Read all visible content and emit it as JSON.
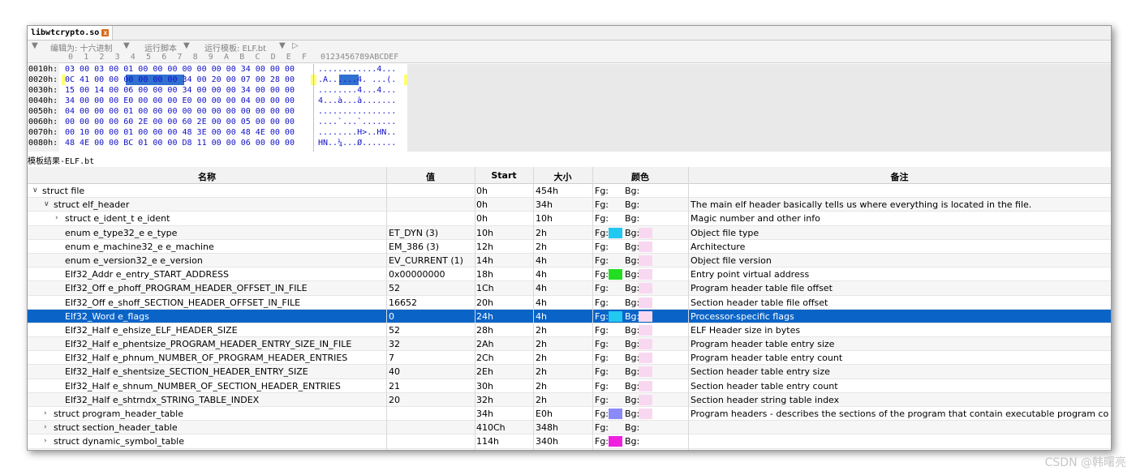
{
  "tab": {
    "title": "libwtcrypto.so",
    "close": "x"
  },
  "toolbar": {
    "arrow": "▼",
    "edit_as": "编辑为: 十六进制",
    "run_script": "运行脚本",
    "run_template": "运行模板: ELF.bt",
    "play": "▷",
    "dropdown": "▼"
  },
  "hex_header": {
    "columns": [
      "0",
      "1",
      "2",
      "3",
      "4",
      "5",
      "6",
      "7",
      "8",
      "9",
      "A",
      "B",
      "C",
      "D",
      "E",
      "F"
    ],
    "ascii_header": "0123456789ABCDEF"
  },
  "hex_rows": [
    {
      "addr": "0010h:",
      "bytes": "03 00 03 00 01 00 00 00 00 00 00 00 34 00 00 00",
      "ascii": "............4..."
    },
    {
      "addr": "0020h:",
      "bytes": "0C 41 00 00 00 00 00 00 34 00 20 00 07 00 28 00",
      "ascii": ".A......4. ...(."
    },
    {
      "addr": "0030h:",
      "bytes": "15 00 14 00 06 00 00 00 34 00 00 00 34 00 00 00",
      "ascii": "........4...4..."
    },
    {
      "addr": "0040h:",
      "bytes": "34 00 00 00 E0 00 00 00 E0 00 00 00 04 00 00 00",
      "ascii": "4...à...à......."
    },
    {
      "addr": "0050h:",
      "bytes": "04 00 00 00 01 00 00 00 00 00 00 00 00 00 00 00",
      "ascii": "................"
    },
    {
      "addr": "0060h:",
      "bytes": "00 00 00 00 60 2E 00 00 60 2E 00 00 05 00 00 00",
      "ascii": "....`...`......."
    },
    {
      "addr": "0070h:",
      "bytes": "00 10 00 00 01 00 00 00 48 3E 00 00 48 4E 00 00",
      "ascii": "........H>..HN.."
    },
    {
      "addr": "0080h:",
      "bytes": "48 4E 00 00 BC 01 00 00 D8 11 00 00 06 00 00 00",
      "ascii": "HN..¼...Ø......."
    }
  ],
  "results_label": "模板结果-ELF.bt",
  "columns": {
    "name": "名称",
    "value": "值",
    "start": "Start",
    "size": "大小",
    "color": "颜色",
    "comment": "备注"
  },
  "rows": [
    {
      "indent": 0,
      "chevron": "∨",
      "name": "struct file",
      "value": "",
      "start": "0h",
      "size": "454h",
      "fg": "Fg:",
      "bg": "Bg:",
      "fg_color": "",
      "bg_color": "",
      "comment": ""
    },
    {
      "indent": 1,
      "chevron": "∨",
      "name": "struct elf_header",
      "value": "",
      "start": "0h",
      "size": "34h",
      "fg": "Fg:",
      "bg": "Bg:",
      "fg_color": "",
      "bg_color": "",
      "comment": "The main elf header basically tells us where everything is located in the file."
    },
    {
      "indent": 2,
      "chevron": "›",
      "name": "struct e_ident_t e_ident",
      "value": "",
      "start": "0h",
      "size": "10h",
      "fg": "Fg:",
      "bg": "Bg:",
      "fg_color": "",
      "bg_color": "",
      "comment": "Magic number and other info"
    },
    {
      "indent": 2,
      "chevron": "",
      "name": "enum e_type32_e e_type",
      "value": "ET_DYN (3)",
      "start": "10h",
      "size": "2h",
      "fg": "Fg:",
      "bg": "Bg:",
      "fg_color": "#22c8f0",
      "bg_color": "#f8d8f0",
      "comment": "Object file type"
    },
    {
      "indent": 2,
      "chevron": "",
      "name": "enum e_machine32_e e_machine",
      "value": "EM_386 (3)",
      "start": "12h",
      "size": "2h",
      "fg": "Fg:",
      "bg": "Bg:",
      "fg_color": "",
      "bg_color": "#f8d8f0",
      "comment": "Architecture"
    },
    {
      "indent": 2,
      "chevron": "",
      "name": "enum e_version32_e e_version",
      "value": "EV_CURRENT (1)",
      "start": "14h",
      "size": "4h",
      "fg": "Fg:",
      "bg": "Bg:",
      "fg_color": "",
      "bg_color": "#f8d8f0",
      "comment": "Object file version"
    },
    {
      "indent": 2,
      "chevron": "",
      "name": "Elf32_Addr e_entry_START_ADDRESS",
      "value": "0x00000000",
      "start": "18h",
      "size": "4h",
      "fg": "Fg:",
      "bg": "Bg:",
      "fg_color": "#22dd22",
      "bg_color": "#f8d8f0",
      "comment": "Entry point virtual address"
    },
    {
      "indent": 2,
      "chevron": "",
      "name": "Elf32_Off e_phoff_PROGRAM_HEADER_OFFSET_IN_FILE",
      "value": "52",
      "start": "1Ch",
      "size": "4h",
      "fg": "Fg:",
      "bg": "Bg:",
      "fg_color": "",
      "bg_color": "#f8d8f0",
      "comment": "Program header table file offset"
    },
    {
      "indent": 2,
      "chevron": "",
      "name": "Elf32_Off e_shoff_SECTION_HEADER_OFFSET_IN_FILE",
      "value": "16652",
      "start": "20h",
      "size": "4h",
      "fg": "Fg:",
      "bg": "Bg:",
      "fg_color": "",
      "bg_color": "#f8d8f0",
      "comment": "Section header table file offset"
    },
    {
      "indent": 2,
      "chevron": "",
      "name": "Elf32_Word e_flags",
      "value": "0",
      "start": "24h",
      "size": "4h",
      "fg": "Fg:",
      "bg": "Bg:",
      "fg_color": "#22c8f0",
      "bg_color": "#f8d8f0",
      "comment": "Processor-specific flags",
      "selected": true
    },
    {
      "indent": 2,
      "chevron": "",
      "name": "Elf32_Half e_ehsize_ELF_HEADER_SIZE",
      "value": "52",
      "start": "28h",
      "size": "2h",
      "fg": "Fg:",
      "bg": "Bg:",
      "fg_color": "",
      "bg_color": "#f8d8f0",
      "comment": "ELF Header size in bytes"
    },
    {
      "indent": 2,
      "chevron": "",
      "name": "Elf32_Half e_phentsize_PROGRAM_HEADER_ENTRY_SIZE_IN_FILE",
      "value": "32",
      "start": "2Ah",
      "size": "2h",
      "fg": "Fg:",
      "bg": "Bg:",
      "fg_color": "",
      "bg_color": "#f8d8f0",
      "comment": "Program header table entry size"
    },
    {
      "indent": 2,
      "chevron": "",
      "name": "Elf32_Half e_phnum_NUMBER_OF_PROGRAM_HEADER_ENTRIES",
      "value": "7",
      "start": "2Ch",
      "size": "2h",
      "fg": "Fg:",
      "bg": "Bg:",
      "fg_color": "",
      "bg_color": "#f8d8f0",
      "comment": "Program header table entry count"
    },
    {
      "indent": 2,
      "chevron": "",
      "name": "Elf32_Half e_shentsize_SECTION_HEADER_ENTRY_SIZE",
      "value": "40",
      "start": "2Eh",
      "size": "2h",
      "fg": "Fg:",
      "bg": "Bg:",
      "fg_color": "",
      "bg_color": "#f8d8f0",
      "comment": "Section header table entry size"
    },
    {
      "indent": 2,
      "chevron": "",
      "name": "Elf32_Half e_shnum_NUMBER_OF_SECTION_HEADER_ENTRIES",
      "value": "21",
      "start": "30h",
      "size": "2h",
      "fg": "Fg:",
      "bg": "Bg:",
      "fg_color": "",
      "bg_color": "#f8d8f0",
      "comment": "Section header table entry count"
    },
    {
      "indent": 2,
      "chevron": "",
      "name": "Elf32_Half e_shtrndx_STRING_TABLE_INDEX",
      "value": "20",
      "start": "32h",
      "size": "2h",
      "fg": "Fg:",
      "bg": "Bg:",
      "fg_color": "",
      "bg_color": "#f8d8f0",
      "comment": "Section header string table index"
    },
    {
      "indent": 1,
      "chevron": "›",
      "name": "struct program_header_table",
      "value": "",
      "start": "34h",
      "size": "E0h",
      "fg": "Fg:",
      "bg": "Bg:",
      "fg_color": "#8a8af8",
      "bg_color": "#f8d8f0",
      "comment": "Program headers - describes the sections of the program that contain executable program cod..."
    },
    {
      "indent": 1,
      "chevron": "›",
      "name": "struct section_header_table",
      "value": "",
      "start": "410Ch",
      "size": "348h",
      "fg": "Fg:",
      "bg": "Bg:",
      "fg_color": "",
      "bg_color": "",
      "comment": ""
    },
    {
      "indent": 1,
      "chevron": "›",
      "name": "struct dynamic_symbol_table",
      "value": "",
      "start": "114h",
      "size": "340h",
      "fg": "Fg:",
      "bg": "Bg:",
      "fg_color": "#f020e0",
      "bg_color": "",
      "comment": ""
    }
  ],
  "watermark": "CSDN @韩曙亮"
}
